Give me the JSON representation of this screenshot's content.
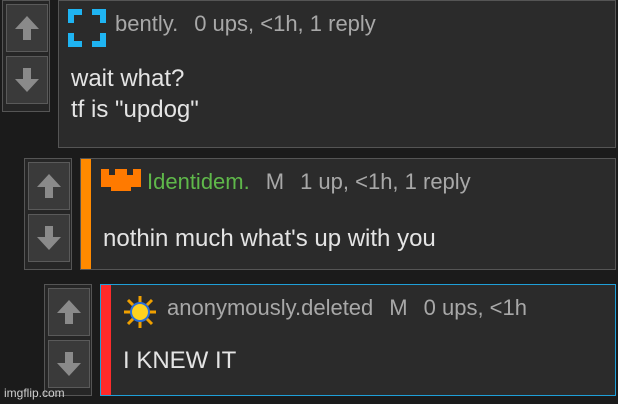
{
  "comments": [
    {
      "username": "bently.",
      "mod_badge": "",
      "stats": "0 ups, <1h, 1 reply",
      "lines": [
        "wait what?",
        "tf is \"updog\""
      ],
      "username_color": "#a8a8a8",
      "accent_color": "",
      "avatar_icon": "frame-corners-icon"
    },
    {
      "username": "Identidem.",
      "mod_badge": "M",
      "stats": "1 up, <1h, 1 reply",
      "lines": [
        "nothin much what's up with you"
      ],
      "username_color": "#5fb84a",
      "accent_color": "#ff8a00",
      "avatar_icon": "orange-crown-icon"
    },
    {
      "username": "anonymously.deleted",
      "mod_badge": "M",
      "stats": "0 ups, <1h",
      "lines": [
        "I KNEW IT"
      ],
      "username_color": "#a8a8a8",
      "accent_color": "#ff2a2a",
      "avatar_icon": "sun-icon"
    }
  ],
  "watermark": "imgflip.com"
}
